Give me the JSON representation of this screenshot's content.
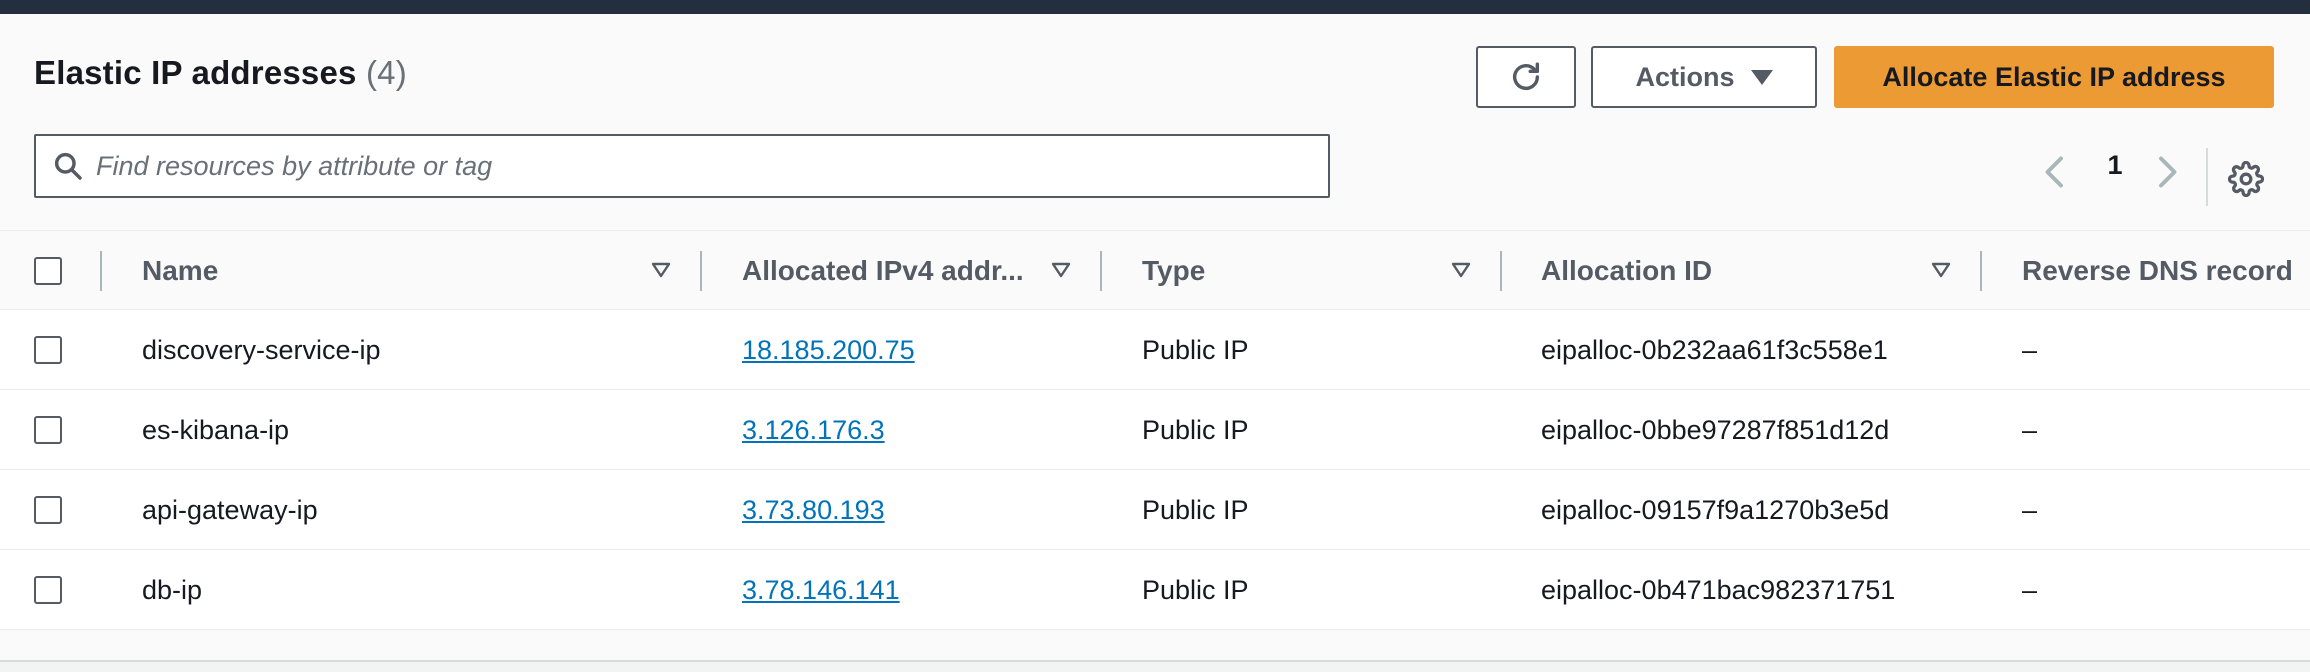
{
  "header": {
    "title": "Elastic IP addresses",
    "count": "(4)",
    "actions_label": "Actions",
    "allocate_label": "Allocate Elastic IP address"
  },
  "search": {
    "placeholder": "Find resources by attribute or tag"
  },
  "pagination": {
    "current_page": "1"
  },
  "table": {
    "columns": [
      {
        "label": "Name"
      },
      {
        "label": "Allocated IPv4 addr..."
      },
      {
        "label": "Type"
      },
      {
        "label": "Allocation ID"
      },
      {
        "label": "Reverse DNS record"
      }
    ],
    "rows": [
      {
        "name": "discovery-service-ip",
        "ipv4": "18.185.200.75",
        "type": "Public IP",
        "allocation_id": "eipalloc-0b232aa61f3c558e1",
        "reverse_dns": "–"
      },
      {
        "name": "es-kibana-ip",
        "ipv4": "3.126.176.3",
        "type": "Public IP",
        "allocation_id": "eipalloc-0bbe97287f851d12d",
        "reverse_dns": "–"
      },
      {
        "name": "api-gateway-ip",
        "ipv4": "3.73.80.193",
        "type": "Public IP",
        "allocation_id": "eipalloc-09157f9a1270b3e5d",
        "reverse_dns": "–"
      },
      {
        "name": "db-ip",
        "ipv4": "3.78.146.141",
        "type": "Public IP",
        "allocation_id": "eipalloc-0b471bac982371751",
        "reverse_dns": "–"
      }
    ]
  },
  "icons": {
    "refresh": "refresh-icon",
    "search": "search-icon",
    "prev": "chevron-left-icon",
    "next": "chevron-right-icon",
    "settings": "gear-icon",
    "sort": "sort-caret-icon"
  },
  "colors": {
    "primary_button": "#ec9a33",
    "link": "#0073bb",
    "topbar": "#232f3e"
  }
}
